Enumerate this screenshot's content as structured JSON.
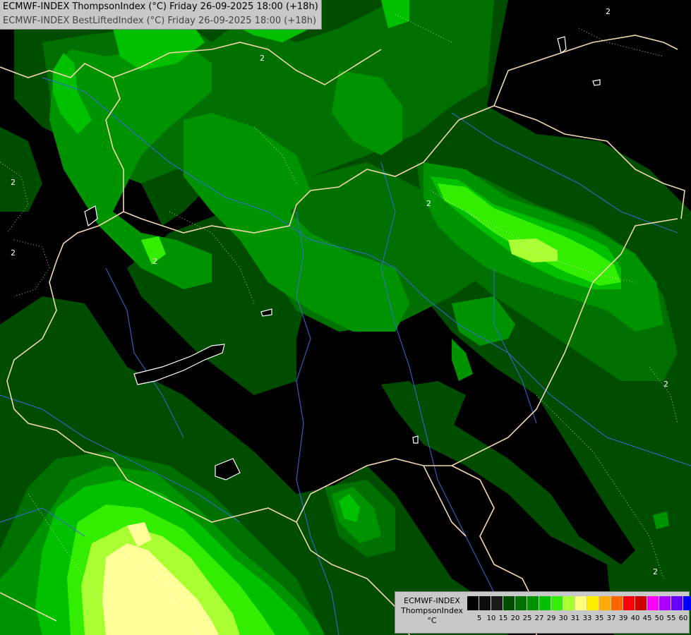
{
  "title": {
    "line1": "ECMWF-INDEX ThompsonIndex (°C) Friday 26-09-2025 18:00 (+18h)",
    "line2": "ECMWF-INDEX BestLiftedIndex (°C) Friday 26-09-2025 18:00 (+18h)"
  },
  "legend": {
    "title_line1": "ECMWF-INDEX",
    "title_line2": "ThompsonIndex",
    "title_line3": "°C",
    "ticks": [
      "5",
      "10",
      "15",
      "20",
      "25",
      "27",
      "29",
      "30",
      "31",
      "33",
      "35",
      "37",
      "39",
      "40",
      "45",
      "50",
      "55",
      "60"
    ],
    "colors": [
      "#000000",
      "#0d0d0d",
      "#1a1a1a",
      "#004d00",
      "#007000",
      "#009300",
      "#00c000",
      "#33ee00",
      "#aaff33",
      "#ffff77",
      "#ffee00",
      "#ffaa00",
      "#ff6600",
      "#ff0000",
      "#cc0000",
      "#ff00ff",
      "#aa00ff",
      "#6600ff",
      "#0000ff"
    ]
  },
  "map": {
    "contour_labels": [
      "2",
      "2",
      "2",
      "2",
      "2",
      "2",
      "2",
      "2"
    ],
    "colors": {
      "background": "#000000",
      "dark_green": "#004d00",
      "mid_green": "#007000",
      "green": "#009300",
      "bright_green": "#00c000",
      "lime": "#33ee00",
      "yellow_green": "#aaff33",
      "pale_yellow": "#ffff99",
      "border": "#f0d8b0",
      "river": "#3a6ad8"
    }
  }
}
